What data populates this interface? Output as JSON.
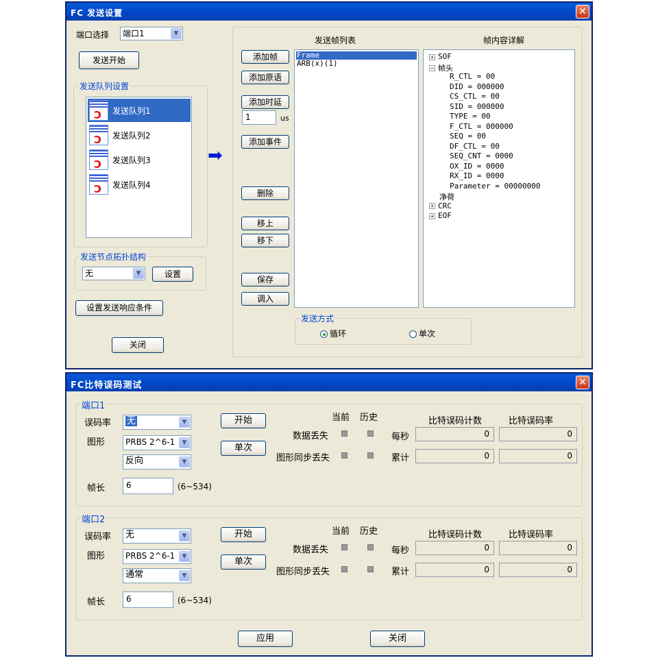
{
  "window1": {
    "title": "FC 发送设置",
    "close_glyph": "✕",
    "port_label": "端口选择",
    "port_value": "端口1",
    "send_start": "发送开始",
    "queue_group_title": "发送队列设置",
    "queues": [
      "发送队列1",
      "发送队列2",
      "发送队列3",
      "发送队列4"
    ],
    "topology_group_title": "发送节点拓扑结构",
    "topology_value": "无",
    "topology_set": "设置",
    "response_button": "设置发送响应条件",
    "close_button": "关闭",
    "frame_list_header": "发送帧列表",
    "frame_detail_header": "帧内容详解",
    "add_frame": "添加帧",
    "add_primitive": "添加原语",
    "add_delay": "添加时延",
    "delay_value": "1",
    "delay_unit": "us",
    "add_event": "添加事件",
    "delete": "删除",
    "move_up": "移上",
    "move_down": "移下",
    "save": "保存",
    "load": "调入",
    "frame_list": [
      "Frame",
      "ARB(x)(1)"
    ],
    "tree": [
      {
        "text": "SOF",
        "box": "+",
        "indent": 0
      },
      {
        "text": "帧头",
        "box": "−",
        "indent": 0
      },
      {
        "text": "R_CTL = 00",
        "box": "",
        "indent": 2
      },
      {
        "text": "DID = 000000",
        "box": "",
        "indent": 2
      },
      {
        "text": "CS_CTL = 00",
        "box": "",
        "indent": 2
      },
      {
        "text": "SID = 000000",
        "box": "",
        "indent": 2
      },
      {
        "text": "TYPE = 00",
        "box": "",
        "indent": 2
      },
      {
        "text": "F_CTL = 000000",
        "box": "",
        "indent": 2
      },
      {
        "text": "SEQ = 00",
        "box": "",
        "indent": 2
      },
      {
        "text": "DF_CTL = 00",
        "box": "",
        "indent": 2
      },
      {
        "text": "SEQ_CNT = 0000",
        "box": "",
        "indent": 2
      },
      {
        "text": "OX_ID = 0000",
        "box": "",
        "indent": 2
      },
      {
        "text": "RX_ID = 0000",
        "box": "",
        "indent": 2
      },
      {
        "text": "Parameter = 00000000",
        "box": "",
        "indent": 2
      },
      {
        "text": "净荷",
        "box": "",
        "indent": 1
      },
      {
        "text": "CRC",
        "box": "+",
        "indent": 0
      },
      {
        "text": "EOF",
        "box": "+",
        "indent": 0
      }
    ],
    "send_mode_title": "发送方式",
    "mode_loop": "循环",
    "mode_single": "单次",
    "arrow_glyph": "➡"
  },
  "window2": {
    "title": "FC比特误码测试",
    "close_glyph": "✕",
    "ports": [
      {
        "title": "端口1",
        "ber_label": "误码率",
        "ber_value": "无",
        "pattern_label": "图形",
        "pattern_value": "PRBS 2^6-1",
        "polarity_value": "反向",
        "frame_len_label": "帧长",
        "frame_len_value": "6",
        "frame_len_range": "(6~534)",
        "start": "开始",
        "single": "单次",
        "current": "当前",
        "history": "历史",
        "data_loss": "数据丢失",
        "sync_loss": "图形同步丢失",
        "per_second": "每秒",
        "cumulative": "累计",
        "bit_err_count": "比特误码计数",
        "bit_err_rate": "比特误码率",
        "ps_count": "0",
        "ps_rate": "0",
        "cu_count": "0",
        "cu_rate": "0"
      },
      {
        "title": "端口2",
        "ber_label": "误码率",
        "ber_value": "无",
        "pattern_label": "图形",
        "pattern_value": "PRBS 2^6-1",
        "polarity_value": "通常",
        "frame_len_label": "帧长",
        "frame_len_value": "6",
        "frame_len_range": "(6~534)",
        "start": "开始",
        "single": "单次",
        "current": "当前",
        "history": "历史",
        "data_loss": "数据丢失",
        "sync_loss": "图形同步丢失",
        "per_second": "每秒",
        "cumulative": "累计",
        "bit_err_count": "比特误码计数",
        "bit_err_rate": "比特误码率",
        "ps_count": "0",
        "ps_rate": "0",
        "cu_count": "0",
        "cu_rate": "0"
      }
    ],
    "apply": "应用",
    "close_button": "关闭"
  }
}
